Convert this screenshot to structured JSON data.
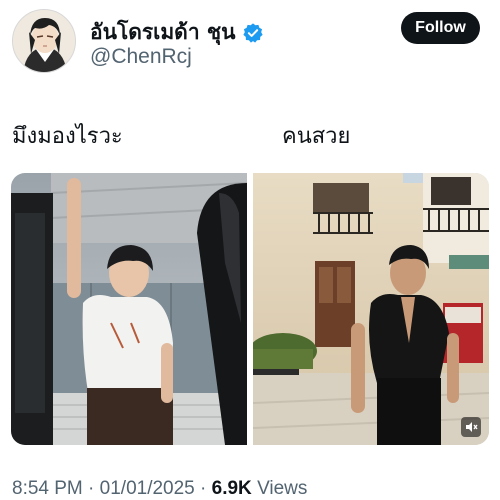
{
  "tweet": {
    "author": {
      "display_name": "อันโดรเมด้า ชุน",
      "handle": "@ChenRcj",
      "verified": true,
      "avatar_icon": "anime-character-avatar"
    },
    "follow_label": "Follow",
    "captions": {
      "left": "มึงมองไรวะ",
      "right": "คนสวย"
    },
    "media": [
      {
        "icon": "photo-man-white-shirt-by-car"
      },
      {
        "icon": "photo-man-black-shirt-street"
      }
    ],
    "meta": {
      "time": "8:54 PM",
      "date": "01/01/2025",
      "separator": "·",
      "views_count": "6.9K",
      "views_label": "Views"
    }
  },
  "colors": {
    "text_primary": "#0f1419",
    "text_secondary": "#536471",
    "verified_blue": "#1d9bf0",
    "follow_bg": "#0f1419",
    "follow_text": "#ffffff"
  }
}
